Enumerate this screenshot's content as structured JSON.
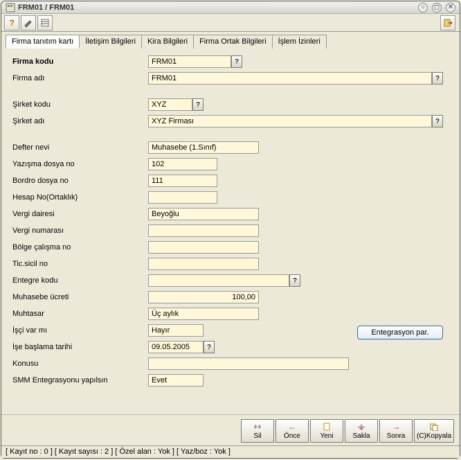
{
  "window": {
    "title": "FRM01 / FRM01"
  },
  "tabs": {
    "t0": "Firma tanıtım kartı",
    "t1": "İletişim Bilgileri",
    "t2": "Kira Bilgileri",
    "t3": "Firma Ortak Bilgileri",
    "t4": "İşlem İzinleri"
  },
  "labels": {
    "firma_kodu": "Firma kodu",
    "firma_adi": "Firma adı",
    "sirket_kodu": "Şirket kodu",
    "sirket_adi": "Şirket adı",
    "defter_nevi": "Defter nevi",
    "yazisma_dosya_no": "Yazışma dosya no",
    "bordro_dosya_no": "Bordro dosya no",
    "hesap_no": "Hesap No(Ortaklık)",
    "vergi_dairesi": "Vergi dairesi",
    "vergi_numarasi": "Vergi numarası",
    "bolge_calisma_no": "Bölge çalışma no",
    "tic_sicil_no": "Tic.sicil no",
    "entegre_kodu": "Entegre kodu",
    "muhasebe_ucreti": "Muhasebe ücreti",
    "muhtasar": "Muhtasar",
    "isci_var_mi": "İşçi var mı",
    "ise_baslama_tarihi": "İşe başlama tarihi",
    "konusu": "Konusu",
    "smm_entegrasyonu": "SMM Entegrasyonu yapılsın"
  },
  "values": {
    "firma_kodu": "FRM01",
    "firma_adi": "FRM01",
    "sirket_kodu": "XYZ",
    "sirket_adi": "XYZ Firması",
    "defter_nevi": "Muhasebe (1.Sınıf)",
    "yazisma_dosya_no": "102",
    "bordro_dosya_no": "111",
    "hesap_no": "",
    "vergi_dairesi": "Beyoğlu",
    "vergi_numarasi": "",
    "bolge_calisma_no": "",
    "tic_sicil_no": "",
    "entegre_kodu": "",
    "muhasebe_ucreti": "100,00",
    "muhtasar": "Üç aylık",
    "isci_var_mi": "Hayır",
    "ise_baslama_tarihi": "09.05.2005",
    "konusu": "",
    "smm_entegrasyonu": "Evet"
  },
  "buttons": {
    "entegrasyon": "Entegrasyon par.",
    "sil": "Sil",
    "once": "Önce",
    "yeni": "Yeni",
    "sakla": "Sakla",
    "sonra": "Sonra",
    "kopyala": "(C)Kopyala"
  },
  "help": "?",
  "status": "[ Kayıt no : 0 ] [ Kayıt sayısı : 2 ] [ Özel alan : Yok ] [ Yaz/boz : Yok ]"
}
